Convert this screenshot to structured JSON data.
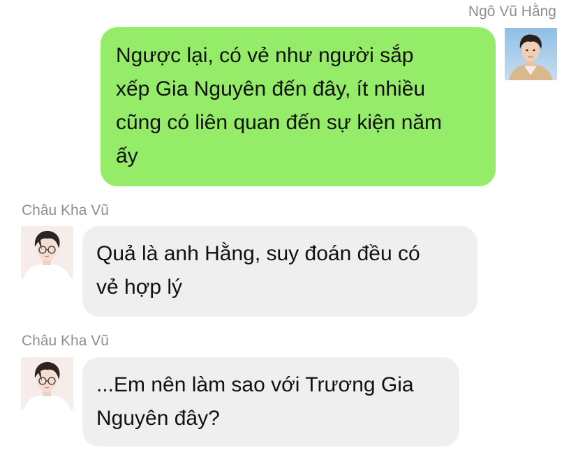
{
  "messages": [
    {
      "direction": "outgoing",
      "sender": "Ngô Vũ Hằng",
      "avatar_icon": "young-man-avatar-icon",
      "lines": [
        "Ngược lại, có vẻ như người sắp",
        "xếp Gia Nguyên đến đây, ít nhiều",
        "cũng có liên quan đến sự kiện năm",
        "ấy"
      ]
    },
    {
      "direction": "incoming",
      "sender": "Châu Kha Vũ",
      "avatar_icon": "man-with-glasses-avatar-icon",
      "lines": [
        "Quả là anh Hằng, suy đoán đều có",
        "vẻ hợp lý"
      ]
    },
    {
      "direction": "incoming",
      "sender": "Châu Kha Vũ",
      "avatar_icon": "man-with-glasses-avatar-icon",
      "lines": [
        "...Em nên làm sao với Trương Gia",
        "Nguyên đây?"
      ]
    }
  ],
  "colors": {
    "outgoing_bubble": "#95ec69",
    "incoming_bubble": "#efeff0",
    "sender_name": "#8e8e93",
    "message_text": "#111111"
  }
}
